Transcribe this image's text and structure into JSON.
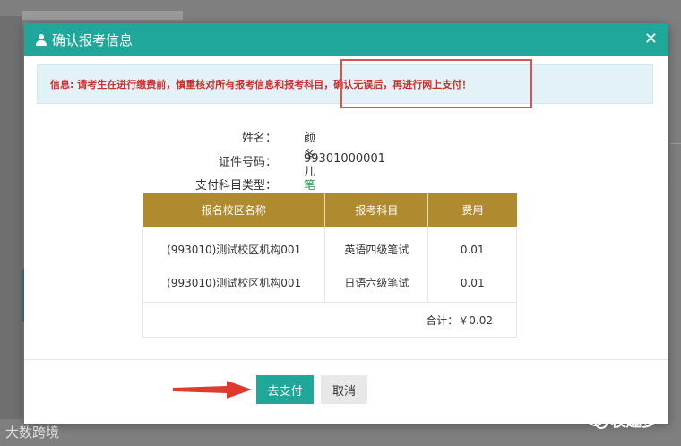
{
  "dialog": {
    "title": "确认报考信息",
    "close_icon": "close-icon",
    "alert_text": "信息: 请考生在进行缴费前，慎重核对所有报考信息和报考科目，确认无误后，再进行网上支付！"
  },
  "info": {
    "name_label": "姓名：",
    "name_value": "颜冬儿",
    "id_label": "证件号码：",
    "id_value": "99301000001",
    "type_label": "支付科目类型：",
    "type_value": "笔试"
  },
  "table": {
    "headers": [
      "报名校区名称",
      "报考科目",
      "费用"
    ],
    "rows": [
      [
        "(993010)测试校区机构001",
        "英语四级笔试",
        "0.01"
      ],
      [
        "(993010)测试校区机构001",
        "日语六级笔试",
        "0.01"
      ]
    ],
    "total": "合计：￥0.02"
  },
  "buttons": {
    "pay": "去支付",
    "cancel": "取消"
  },
  "watermarks": {
    "left": "大数跨境",
    "right": "校趣多"
  },
  "colors": {
    "header": "#1fa89a",
    "table_header": "#b08a2f",
    "alert_text": "#c9302c",
    "highlight_border": "#d9534f",
    "arrow": "#e03a2c"
  }
}
